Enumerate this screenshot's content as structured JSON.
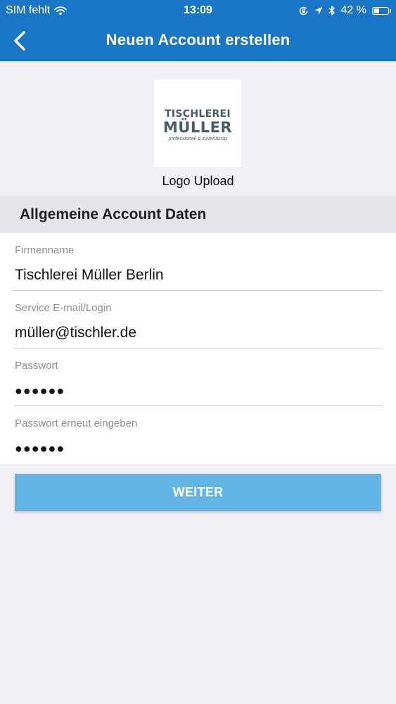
{
  "status_bar": {
    "carrier": "SIM fehlt",
    "time": "13:09",
    "battery_percent_text": "42 %",
    "battery_level": 0.42,
    "icons": [
      "wifi-icon",
      "rotation-lock-icon",
      "location-arrow-icon",
      "bluetooth-icon",
      "battery-icon"
    ]
  },
  "nav": {
    "title": "Neuen Account erstellen",
    "back_icon": "chevron-left-icon"
  },
  "logo": {
    "line1": "TISCHLEREI",
    "line2": "MÜLLER",
    "line3": "professionell & zuverlässig",
    "caption": "Logo Upload"
  },
  "section": {
    "title": "Allgemeine Account Daten"
  },
  "form": {
    "fields": [
      {
        "label": "Firmenname",
        "value": "Tischlerei Müller Berlin"
      },
      {
        "label": "Service E-mail/Login",
        "value": "müller@tischler.de"
      },
      {
        "label": "Passwort",
        "value": "●●●●●●"
      },
      {
        "label": "Passwort erneut eingeben",
        "value": "●●●●●●"
      }
    ]
  },
  "button": {
    "label": "WEITER"
  },
  "colors": {
    "header": "#1976c6",
    "button": "#62b5e5",
    "background": "#efeff4",
    "section_header": "#e6e6ea"
  }
}
